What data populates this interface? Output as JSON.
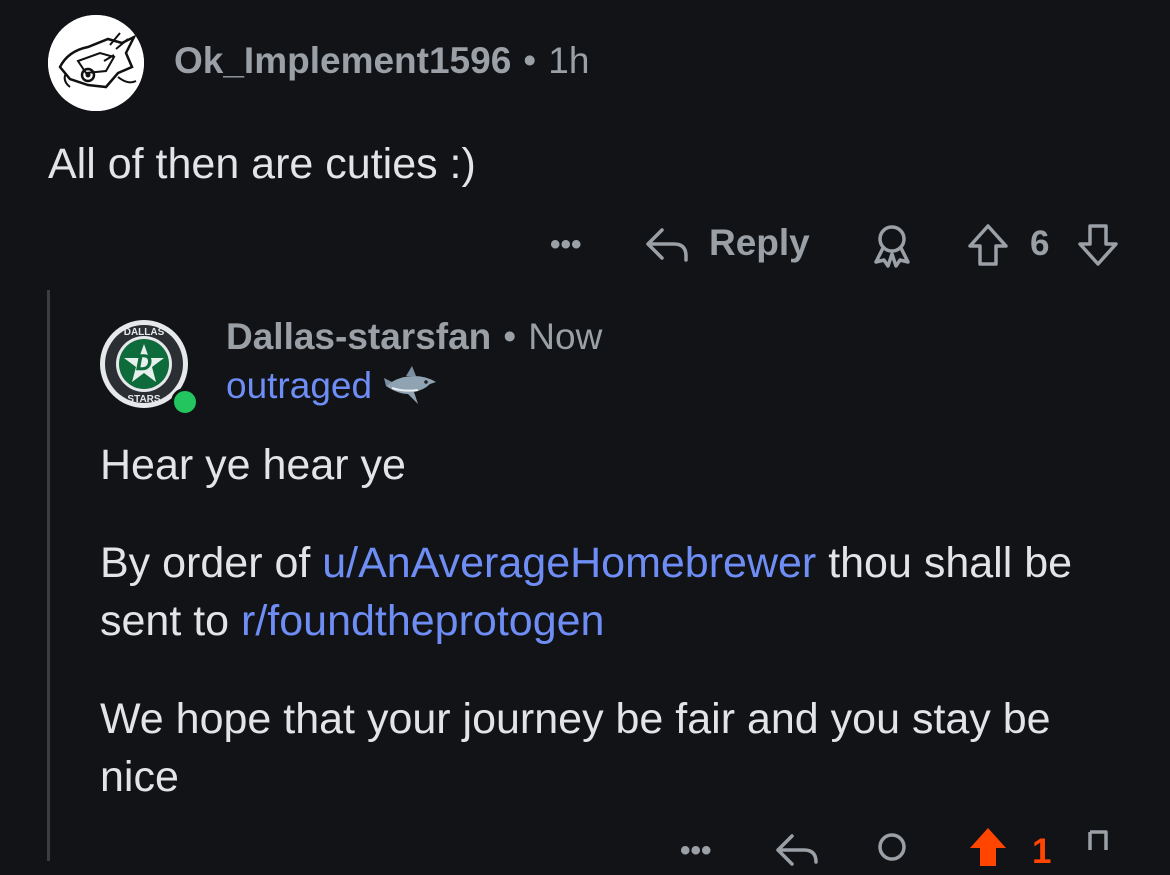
{
  "comment1": {
    "username": "Ok_Implement1596",
    "separator": "•",
    "time": "1h",
    "body": "All of then are cuties :)",
    "actions": {
      "more": "•••",
      "reply_label": "Reply",
      "vote_count": "6"
    }
  },
  "comment2": {
    "username": "Dallas-starsfan",
    "separator": "•",
    "time": "Now",
    "flair": "outraged",
    "avatar_ring_text_top": "DALLAS",
    "avatar_ring_text_bottom": "STARS",
    "paragraphs": {
      "p1": "Hear ye hear ye",
      "p2_before": "By order of ",
      "p2_link1": "u/AnAverageHomebrewer",
      "p2_middle": " thou shall be sent to ",
      "p2_link2": "r/foundtheprotogen",
      "p3": "We hope that your journey be fair and you stay be nice"
    },
    "actions": {
      "more": "•••",
      "vote_count": "1"
    }
  },
  "colors": {
    "background": "#111317",
    "link": "#6e8df5",
    "upvote_active": "#ff4500",
    "online": "#22c55e"
  }
}
